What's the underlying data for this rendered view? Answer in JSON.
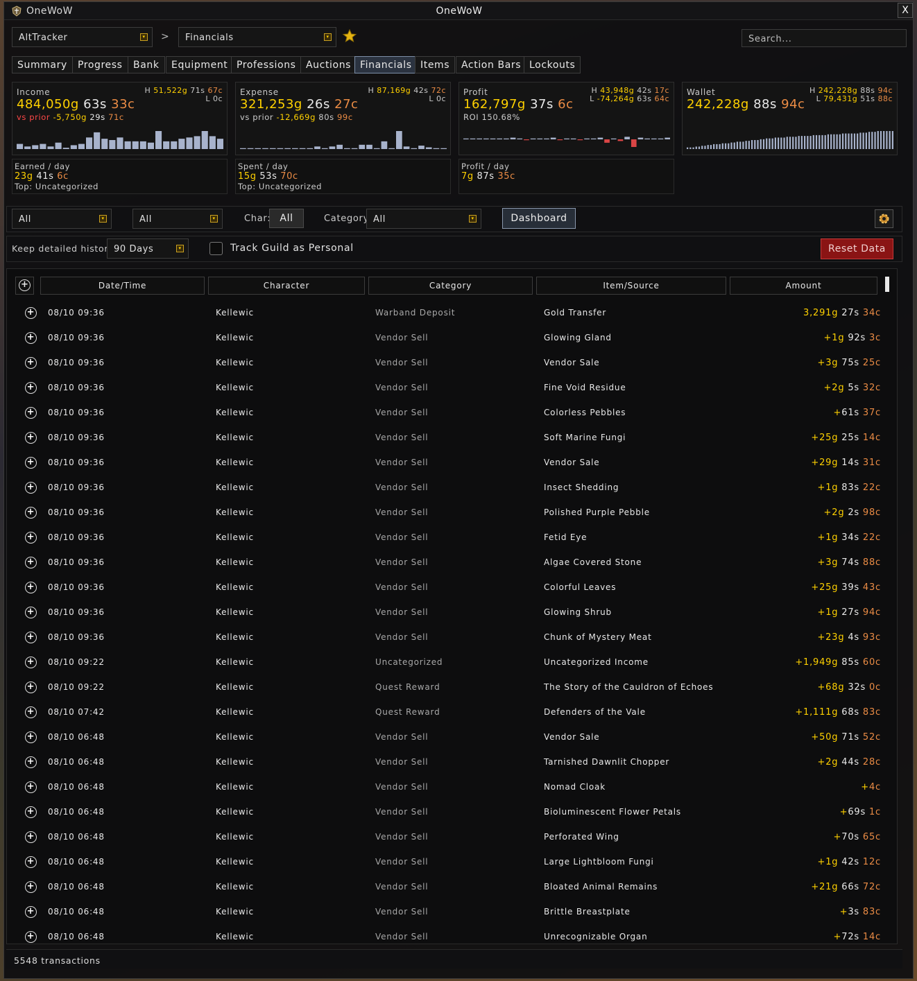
{
  "app_name": "OneWoW",
  "window_title": "OneWoW",
  "close_label": "X",
  "nav": {
    "module": "AltTracker",
    "section": "Financials",
    "search_placeholder": "Search..."
  },
  "tabs": [
    {
      "label": "Summary"
    },
    {
      "label": "Progress"
    },
    {
      "label": "Bank"
    },
    {
      "label": "Equipment"
    },
    {
      "label": "Professions"
    },
    {
      "label": "Auctions"
    },
    {
      "label": "Financials",
      "active": true
    },
    {
      "label": "Items"
    },
    {
      "label": "Action Bars"
    },
    {
      "label": "Lockouts"
    }
  ],
  "cards": {
    "income": {
      "label": "Income",
      "g": "484,050g",
      "s": "63s",
      "c": "33c",
      "prior_label": "vs prior",
      "prior_g": "-5,750g",
      "prior_s": "29s",
      "prior_c": "71c",
      "high_label": "H",
      "high_g": "51,522g",
      "high_s": "71s",
      "high_c": "67c",
      "low": "L 0c",
      "bars": [
        4,
        2,
        3,
        4,
        2,
        5,
        1,
        3,
        4,
        9,
        13,
        8,
        7,
        9,
        6,
        6,
        6,
        5,
        14,
        6,
        6,
        8,
        9,
        10,
        14,
        10,
        8
      ],
      "sub_label": "Earned / day",
      "sub_g": "23g",
      "sub_s": "41s",
      "sub_c": "6c",
      "sub_top": "Top: Uncategorized"
    },
    "expense": {
      "label": "Expense",
      "g": "321,253g",
      "s": "26s",
      "c": "27c",
      "prior_label": "vs prior",
      "prior_g": "-12,669g",
      "prior_s": "80s",
      "prior_c": "99c",
      "high_label": "H",
      "high_g": "87,169g",
      "high_s": "42s",
      "high_c": "72c",
      "low": "L 0c",
      "bars": [
        1,
        1,
        1,
        1,
        1,
        1,
        1,
        1,
        1,
        1,
        3,
        1,
        3,
        5,
        1,
        1,
        5,
        5,
        1,
        9,
        1,
        21,
        3,
        1,
        4,
        2,
        1,
        1
      ],
      "sub_label": "Spent / day",
      "sub_g": "15g",
      "sub_s": "53s",
      "sub_c": "70c",
      "sub_top": "Top: Uncategorized"
    },
    "profit": {
      "label": "Profit",
      "g": "162,797g",
      "s": "37s",
      "c": "6c",
      "roi": "ROI 150.68%",
      "high_label": "H",
      "high_g": "43,948g",
      "high_s": "42s",
      "high_c": "17c",
      "low_label": "L",
      "low_g": "-74,264g",
      "low_s": "63s",
      "low_c": "64c",
      "bars": [
        1,
        1,
        1,
        1,
        1,
        1,
        1,
        2,
        1,
        -1,
        1,
        1,
        1,
        2,
        -1,
        1,
        1,
        -1,
        1,
        1,
        2,
        -4,
        1,
        -2,
        3,
        -9,
        2,
        1,
        1,
        1,
        2
      ],
      "sub_label": "Profit / day",
      "sub_g": "7g",
      "sub_s": "87s",
      "sub_c": "35c"
    },
    "wallet": {
      "label": "Wallet",
      "g": "242,228g",
      "s": "88s",
      "c": "94c",
      "high_label": "H",
      "high_g": "242,228g",
      "high_s": "88s",
      "high_c": "94c",
      "low_label": "L",
      "low_g": "79,431g",
      "low_s": "51s",
      "low_c": "88c",
      "bars": [
        2,
        2,
        2,
        3,
        3,
        4,
        4,
        5,
        5,
        6,
        6,
        6,
        7,
        7,
        7,
        8,
        8,
        9,
        9,
        9,
        10,
        10,
        11,
        11,
        11,
        12,
        12,
        13,
        13,
        13,
        14,
        14,
        14,
        14,
        15,
        15,
        15,
        15,
        16,
        16,
        16,
        16,
        16,
        17,
        17,
        17,
        17,
        17,
        18,
        18,
        18,
        18,
        18,
        19,
        19,
        19,
        19,
        19,
        19,
        20,
        20,
        20,
        21,
        21,
        21,
        22,
        22,
        22,
        22,
        22,
        22
      ]
    }
  },
  "filters": {
    "f1": "All",
    "f2": "All",
    "char_label": "Char:",
    "char_value": "All",
    "category_label": "Category",
    "category_value": "All",
    "dashboard": "Dashboard"
  },
  "history": {
    "label": "Keep detailed history",
    "value": "90 Days",
    "track_guild": "Track Guild as Personal",
    "reset": "Reset Data"
  },
  "columns": [
    "Date/Time",
    "Character",
    "Category",
    "Item/Source",
    "Amount"
  ],
  "rows": [
    {
      "dt": "08/10 09:36",
      "ch": "Kellewic",
      "cat": "Warband Deposit",
      "item": "Gold Transfer",
      "sign": "",
      "g": "3,291g",
      "s": "27s",
      "c": "34c"
    },
    {
      "dt": "08/10 09:36",
      "ch": "Kellewic",
      "cat": "Vendor Sell",
      "item": "Glowing Gland",
      "sign": "+",
      "g": "1g",
      "s": "92s",
      "c": "3c"
    },
    {
      "dt": "08/10 09:36",
      "ch": "Kellewic",
      "cat": "Vendor Sell",
      "item": "Vendor Sale",
      "sign": "+",
      "g": "3g",
      "s": "75s",
      "c": "25c"
    },
    {
      "dt": "08/10 09:36",
      "ch": "Kellewic",
      "cat": "Vendor Sell",
      "item": "Fine Void Residue",
      "sign": "+",
      "g": "2g",
      "s": "5s",
      "c": "32c"
    },
    {
      "dt": "08/10 09:36",
      "ch": "Kellewic",
      "cat": "Vendor Sell",
      "item": "Colorless Pebbles",
      "sign": "+",
      "g": "",
      "s": "61s",
      "c": "37c"
    },
    {
      "dt": "08/10 09:36",
      "ch": "Kellewic",
      "cat": "Vendor Sell",
      "item": "Soft Marine Fungi",
      "sign": "+",
      "g": "25g",
      "s": "25s",
      "c": "14c"
    },
    {
      "dt": "08/10 09:36",
      "ch": "Kellewic",
      "cat": "Vendor Sell",
      "item": "Vendor Sale",
      "sign": "+",
      "g": "29g",
      "s": "14s",
      "c": "31c"
    },
    {
      "dt": "08/10 09:36",
      "ch": "Kellewic",
      "cat": "Vendor Sell",
      "item": "Insect Shedding",
      "sign": "+",
      "g": "1g",
      "s": "83s",
      "c": "22c"
    },
    {
      "dt": "08/10 09:36",
      "ch": "Kellewic",
      "cat": "Vendor Sell",
      "item": "Polished Purple Pebble",
      "sign": "+",
      "g": "2g",
      "s": "2s",
      "c": "98c"
    },
    {
      "dt": "08/10 09:36",
      "ch": "Kellewic",
      "cat": "Vendor Sell",
      "item": "Fetid Eye",
      "sign": "+",
      "g": "1g",
      "s": "34s",
      "c": "22c"
    },
    {
      "dt": "08/10 09:36",
      "ch": "Kellewic",
      "cat": "Vendor Sell",
      "item": "Algae Covered Stone",
      "sign": "+",
      "g": "3g",
      "s": "74s",
      "c": "88c"
    },
    {
      "dt": "08/10 09:36",
      "ch": "Kellewic",
      "cat": "Vendor Sell",
      "item": "Colorful Leaves",
      "sign": "+",
      "g": "25g",
      "s": "39s",
      "c": "43c"
    },
    {
      "dt": "08/10 09:36",
      "ch": "Kellewic",
      "cat": "Vendor Sell",
      "item": "Glowing Shrub",
      "sign": "+",
      "g": "1g",
      "s": "27s",
      "c": "94c"
    },
    {
      "dt": "08/10 09:36",
      "ch": "Kellewic",
      "cat": "Vendor Sell",
      "item": "Chunk of Mystery Meat",
      "sign": "+",
      "g": "23g",
      "s": "4s",
      "c": "93c"
    },
    {
      "dt": "08/10 09:22",
      "ch": "Kellewic",
      "cat": "Uncategorized",
      "item": "Uncategorized Income",
      "sign": "+",
      "g": "1,949g",
      "s": "85s",
      "c": "60c"
    },
    {
      "dt": "08/10 09:22",
      "ch": "Kellewic",
      "cat": "Quest Reward",
      "item": "The Story of the Cauldron of Echoes",
      "sign": "+",
      "g": "68g",
      "s": "32s",
      "c": "0c"
    },
    {
      "dt": "08/10 07:42",
      "ch": "Kellewic",
      "cat": "Quest Reward",
      "item": "Defenders of the Vale",
      "sign": "+",
      "g": "1,111g",
      "s": "68s",
      "c": "83c"
    },
    {
      "dt": "08/10 06:48",
      "ch": "Kellewic",
      "cat": "Vendor Sell",
      "item": "Vendor Sale",
      "sign": "+",
      "g": "50g",
      "s": "71s",
      "c": "52c"
    },
    {
      "dt": "08/10 06:48",
      "ch": "Kellewic",
      "cat": "Vendor Sell",
      "item": "Tarnished Dawnlit Chopper",
      "sign": "+",
      "g": "2g",
      "s": "44s",
      "c": "28c"
    },
    {
      "dt": "08/10 06:48",
      "ch": "Kellewic",
      "cat": "Vendor Sell",
      "item": "Nomad Cloak",
      "sign": "+",
      "g": "",
      "s": "",
      "c": "4c"
    },
    {
      "dt": "08/10 06:48",
      "ch": "Kellewic",
      "cat": "Vendor Sell",
      "item": "Bioluminescent Flower Petals",
      "sign": "+",
      "g": "",
      "s": "69s",
      "c": "1c"
    },
    {
      "dt": "08/10 06:48",
      "ch": "Kellewic",
      "cat": "Vendor Sell",
      "item": "Perforated Wing",
      "sign": "+",
      "g": "",
      "s": "70s",
      "c": "65c"
    },
    {
      "dt": "08/10 06:48",
      "ch": "Kellewic",
      "cat": "Vendor Sell",
      "item": "Large Lightbloom Fungi",
      "sign": "+",
      "g": "1g",
      "s": "42s",
      "c": "12c"
    },
    {
      "dt": "08/10 06:48",
      "ch": "Kellewic",
      "cat": "Vendor Sell",
      "item": "Bloated Animal Remains",
      "sign": "+",
      "g": "21g",
      "s": "66s",
      "c": "72c"
    },
    {
      "dt": "08/10 06:48",
      "ch": "Kellewic",
      "cat": "Vendor Sell",
      "item": "Brittle Breastplate",
      "sign": "+",
      "g": "",
      "s": "3s",
      "c": "83c"
    },
    {
      "dt": "08/10 06:48",
      "ch": "Kellewic",
      "cat": "Vendor Sell",
      "item": "Unrecognizable Organ",
      "sign": "+",
      "g": "",
      "s": "72s",
      "c": "14c"
    }
  ],
  "footer": {
    "count": "5548 transactions"
  }
}
